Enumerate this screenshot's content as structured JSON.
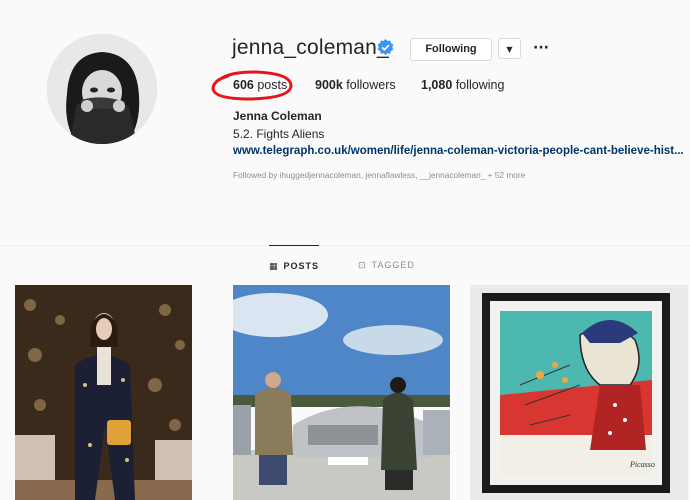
{
  "profile": {
    "username": "jenna_coleman_",
    "full_name": "Jenna Coleman",
    "bio": "5.2. Fights Aliens",
    "link": "www.telegraph.co.uk/women/life/jenna-coleman-victoria-people-cant-believe-hist...",
    "verified": true
  },
  "actions": {
    "following_label": "Following",
    "dropdown_glyph": "▼",
    "more_glyph": "···"
  },
  "stats": {
    "posts_count": "606",
    "posts_label": "posts",
    "followers_count": "900k",
    "followers_label": "followers",
    "following_count": "1,080",
    "following_label": "following"
  },
  "followed_by": {
    "prefix": "Followed by",
    "users": "ihuggedjennacoleman, jennaflawless, __jennacoleman_",
    "more": "+ 52 more"
  },
  "tabs": [
    {
      "label": "POSTS",
      "icon": "grid-icon",
      "active": true
    },
    {
      "label": "TAGGED",
      "icon": "tag-icon",
      "active": false
    }
  ],
  "colors": {
    "link": "#003569",
    "verified": "#3897f0",
    "annotation": "#e8141c"
  },
  "posts": [
    {
      "subject": "portrait-in-suit"
    },
    {
      "subject": "car-photo"
    },
    {
      "subject": "painting"
    }
  ],
  "artwork": {
    "signature": "Picasso"
  }
}
